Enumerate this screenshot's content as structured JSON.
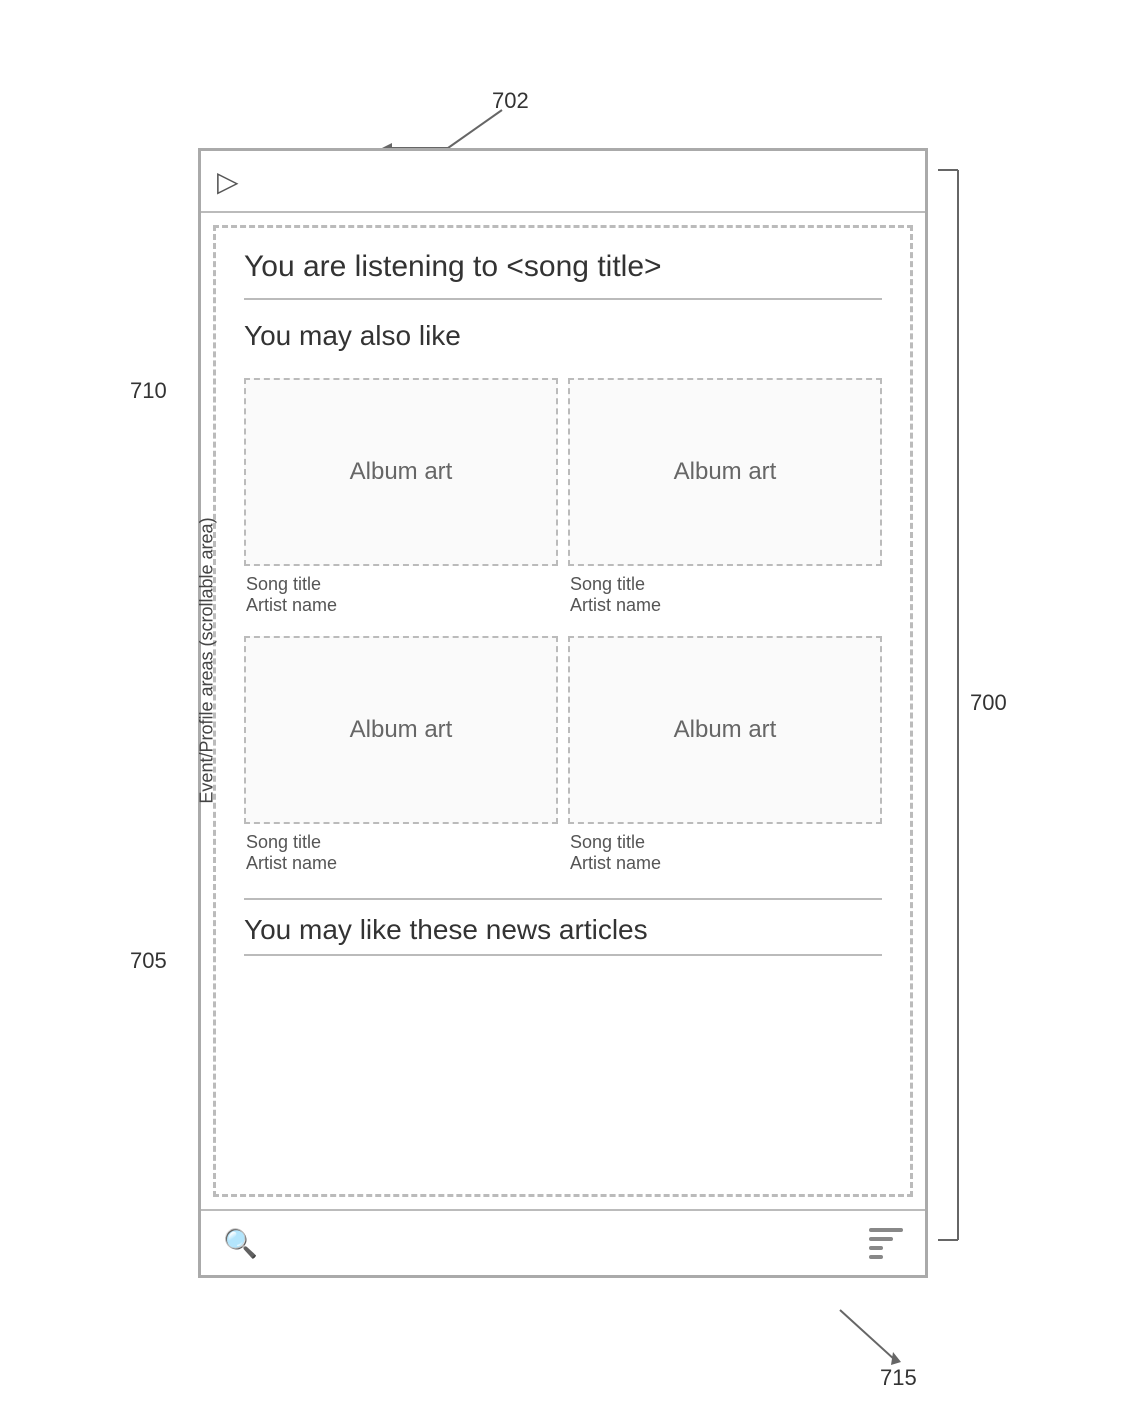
{
  "annotations": {
    "label_702": "702",
    "label_710": "710",
    "label_705": "705",
    "label_700": "700",
    "label_715": "715"
  },
  "ui": {
    "now_playing": "You are listening to <song title>",
    "you_may_also_like": "You may also like",
    "album_art_label": "Album art",
    "song_title": "Song title",
    "artist_name": "Artist name",
    "news_section_title": "You may like these news articles",
    "scrollable_area_label": "Event/Profile areas (scrollable area)"
  },
  "bottom_bar": {
    "search_icon": "search-icon",
    "menu_icon": "menu-icon"
  },
  "album_items": [
    {
      "id": 1,
      "art": "Album art",
      "song": "Song title",
      "artist": "Artist name"
    },
    {
      "id": 2,
      "art": "Album art",
      "song": "Song title",
      "artist": "Artist name"
    },
    {
      "id": 3,
      "art": "Album art",
      "song": "Song title",
      "artist": "Artist name"
    },
    {
      "id": 4,
      "art": "Album art",
      "song": "Song title",
      "artist": "Artist name"
    }
  ]
}
